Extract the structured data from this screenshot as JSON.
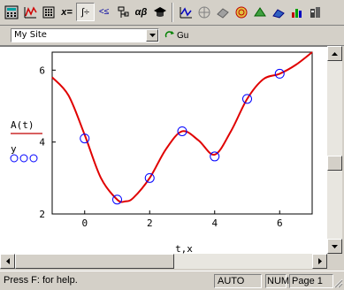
{
  "toolbar": {
    "buttons": [
      {
        "name": "calculator-palette-icon"
      },
      {
        "name": "graph-palette-icon"
      },
      {
        "name": "matrix-palette-icon"
      },
      {
        "name": "evaluation-palette-icon",
        "label": "x="
      },
      {
        "name": "calculus-palette-icon",
        "label": "∫÷"
      },
      {
        "name": "boolean-palette-icon",
        "label": "<≤"
      },
      {
        "name": "programming-palette-icon"
      },
      {
        "name": "greek-palette-icon",
        "label": "αβ"
      },
      {
        "name": "symbolic-palette-icon"
      },
      {
        "name": "xy-plot-icon"
      },
      {
        "name": "polar-plot-icon"
      },
      {
        "name": "surface-plot-icon"
      },
      {
        "name": "contour-plot-icon"
      },
      {
        "name": "3d-scatter-icon"
      },
      {
        "name": "3d-bar-icon"
      },
      {
        "name": "vector-field-icon"
      }
    ]
  },
  "stylebar": {
    "style_value": "My Site",
    "go_label": "Gu"
  },
  "plot": {
    "y_label_1": "A(t)",
    "y_label_2": "y",
    "x_label": "t,x",
    "x_ticks": [
      "0",
      "2",
      "4",
      "6"
    ],
    "y_ticks": [
      "2",
      "4",
      "6"
    ],
    "line_color": "#e00000",
    "marker_color": "#0000ff"
  },
  "chart_data": {
    "type": "scatter",
    "xlim": [
      -1,
      7
    ],
    "ylim": [
      2,
      6.5
    ],
    "xlabel": "t,x",
    "ylabel": "A(t) / y",
    "x_ticks": [
      0,
      2,
      4,
      6
    ],
    "y_ticks": [
      2,
      4,
      6
    ],
    "series": [
      {
        "style": "line",
        "color": "#e00000",
        "x": [
          -1,
          -0.5,
          0,
          0.5,
          1,
          1.25,
          1.5,
          2,
          2.5,
          3,
          3.5,
          4,
          4.5,
          5,
          5.5,
          6,
          6.5,
          7
        ],
        "y": [
          5.8,
          5.3,
          4.2,
          3.0,
          2.4,
          2.35,
          2.45,
          3.0,
          3.8,
          4.3,
          4.05,
          3.65,
          4.3,
          5.2,
          5.75,
          5.9,
          6.15,
          6.5
        ]
      },
      {
        "style": "markers",
        "color": "#0000ff",
        "x": [
          0,
          1,
          2,
          3,
          4,
          5,
          6
        ],
        "y": [
          4.1,
          2.4,
          3.0,
          4.3,
          3.6,
          5.2,
          5.9
        ]
      }
    ]
  },
  "status": {
    "help": "Press F: for help.",
    "auto": "AUTO",
    "num": "NUM",
    "page": "Page 1"
  }
}
